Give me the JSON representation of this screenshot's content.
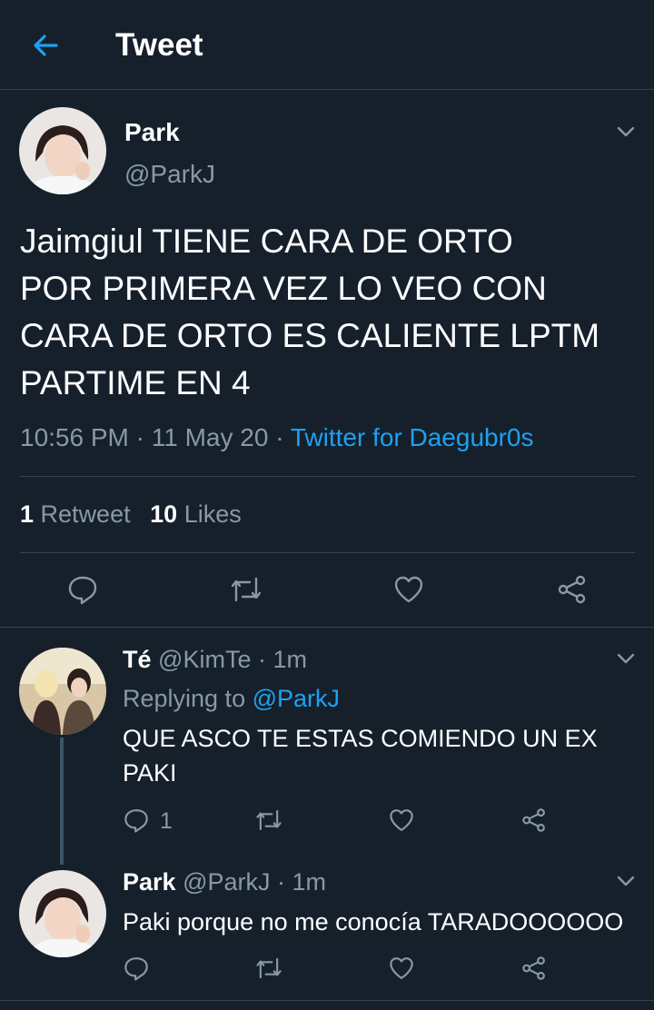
{
  "header": {
    "title": "Tweet"
  },
  "tweet": {
    "name": "Park",
    "handle": "@ParkJ",
    "text_lines": [
      "Jaimgiul TIENE CARA DE ORTO",
      "POR PRIMERA VEZ LO VEO CON",
      "CARA DE ORTO ES CALIENTE LPTM",
      "PARTIME EN 4"
    ],
    "time": "10:56 PM",
    "date": "11 May 20",
    "sep": "·",
    "source": "Twitter for Daegubr0s",
    "retweets_count": "1",
    "retweets_label": "Retweet",
    "likes_count": "10",
    "likes_label": "Likes"
  },
  "replies": [
    {
      "name": "Té",
      "handle": "@KimTe",
      "time": "· 1m",
      "replying_prefix": "Replying to",
      "replying_to": "@ParkJ",
      "text_lines": [
        "QUE ASCO TE ESTAS COMIENDO UN EX",
        "PAKI"
      ],
      "reply_count": "1"
    },
    {
      "name": "Park",
      "handle": "@ParkJ",
      "time": "· 1m",
      "text_lines": [
        "Paki porque no me conocía TARADOOOOOO"
      ]
    }
  ],
  "colors": {
    "background": "#15202b",
    "accent": "#1da1f2",
    "muted": "#8899a6",
    "divider": "#38444d"
  }
}
